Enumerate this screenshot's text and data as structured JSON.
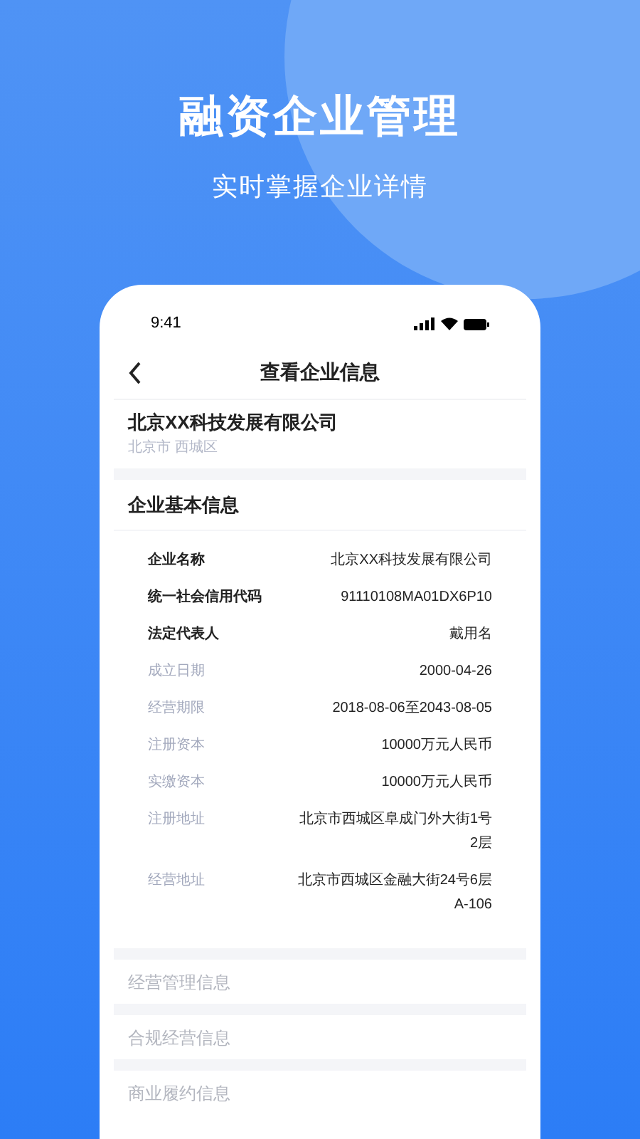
{
  "headline": "融资企业管理",
  "subheadline": "实时掌握企业详情",
  "status_bar": {
    "time": "9:41"
  },
  "nav": {
    "title": "查看企业信息"
  },
  "company": {
    "name": "北京XX科技发展有限公司",
    "district": "北京市 西城区"
  },
  "basic_info": {
    "title": "企业基本信息",
    "fields": [
      {
        "kind": "key",
        "label": "企业名称",
        "value": "北京XX科技发展有限公司"
      },
      {
        "kind": "key",
        "label": "统一社会信用代码",
        "value": "91110108MA01DX6P10"
      },
      {
        "kind": "key",
        "label": "法定代表人",
        "value": "戴用名"
      },
      {
        "kind": "plain",
        "label": "成立日期",
        "value": "2000-04-26"
      },
      {
        "kind": "plain",
        "label": "经营期限",
        "value": "2018-08-06至2043-08-05"
      },
      {
        "kind": "plain",
        "label": "注册资本",
        "value": "10000万元人民币"
      },
      {
        "kind": "plain",
        "label": "实缴资本",
        "value": "10000万元人民币"
      },
      {
        "kind": "plain",
        "label": "注册地址",
        "value": "北京市西城区阜成门外大街1号\n2层"
      },
      {
        "kind": "plain",
        "label": "经营地址",
        "value": "北京市西城区金融大街24号6层\nA-106"
      }
    ]
  },
  "sections": [
    "经营管理信息",
    "合规经营信息",
    "商业履约信息"
  ]
}
